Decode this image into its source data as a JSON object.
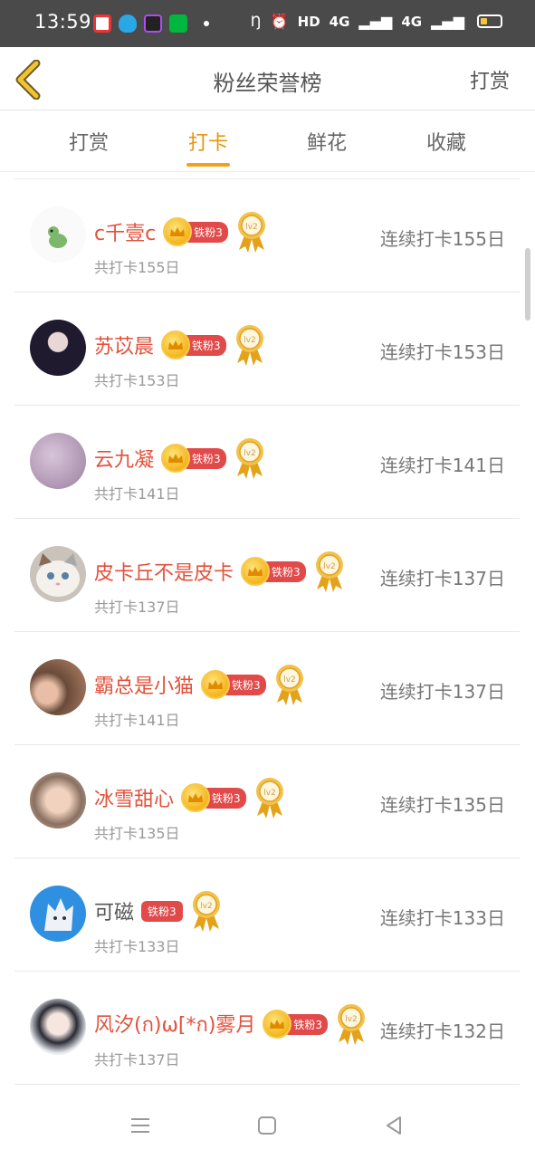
{
  "status_bar": {
    "time": "13:59",
    "net_label": "HD",
    "signal1": "4G",
    "signal2": "4G"
  },
  "header": {
    "title": "粉丝荣誉榜",
    "right_action": "打赏"
  },
  "tabs": [
    {
      "label": "打赏"
    },
    {
      "label": "打卡"
    },
    {
      "label": "鲜花"
    },
    {
      "label": "收藏"
    }
  ],
  "colors": {
    "accent": "#f2a11b",
    "name_red": "#e2513b",
    "badge_red": "#e24a4a"
  },
  "badge_text": "铁粉3",
  "medal_text": "lv2",
  "rows": [
    {
      "name": "c千壹c",
      "total": "共打卡155日",
      "streak": "连续打卡155日"
    },
    {
      "name": "苏苡晨",
      "total": "共打卡153日",
      "streak": "连续打卡153日"
    },
    {
      "name": "云九凝",
      "total": "共打卡141日",
      "streak": "连续打卡141日"
    },
    {
      "name": "皮卡丘不是皮卡",
      "total": "共打卡137日",
      "streak": "连续打卡137日"
    },
    {
      "name": "霸总是小猫",
      "total": "共打卡141日",
      "streak": "连续打卡137日"
    },
    {
      "name": "冰雪甜心",
      "total": "共打卡135日",
      "streak": "连续打卡135日"
    },
    {
      "name": "可磁",
      "total": "共打卡133日",
      "streak": "连续打卡133日"
    },
    {
      "name": "风汐(ก)ω[*ก)雾月",
      "total": "共打卡137日",
      "streak": "连续打卡132日"
    }
  ]
}
